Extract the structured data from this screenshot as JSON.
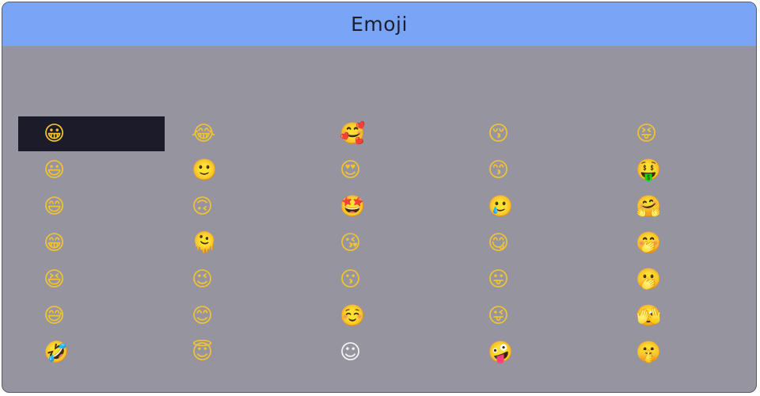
{
  "window": {
    "title": "Emoji"
  },
  "emoji_grid": {
    "selected_index": 0,
    "columns": [
      [
        "😀",
        "😃",
        "😄",
        "😁",
        "😆",
        "😅",
        "🤣"
      ],
      [
        "😂",
        "🙂",
        "🙃",
        "🫠",
        "😉",
        "😊",
        "😇"
      ],
      [
        "🥰",
        "😍",
        "🤩",
        "😘",
        "😗",
        "☺️",
        "☺"
      ],
      [
        "😚",
        "😙",
        "🥲",
        "😋",
        "😛",
        "😜",
        "🤪"
      ],
      [
        "😝",
        "🤑",
        "🤗",
        "🤭",
        "🫢",
        "🫣",
        "🤫"
      ]
    ]
  },
  "colors": {
    "titlebar": "#7aa5f7",
    "background": "#96959f",
    "selection": "#1c1b2a"
  }
}
